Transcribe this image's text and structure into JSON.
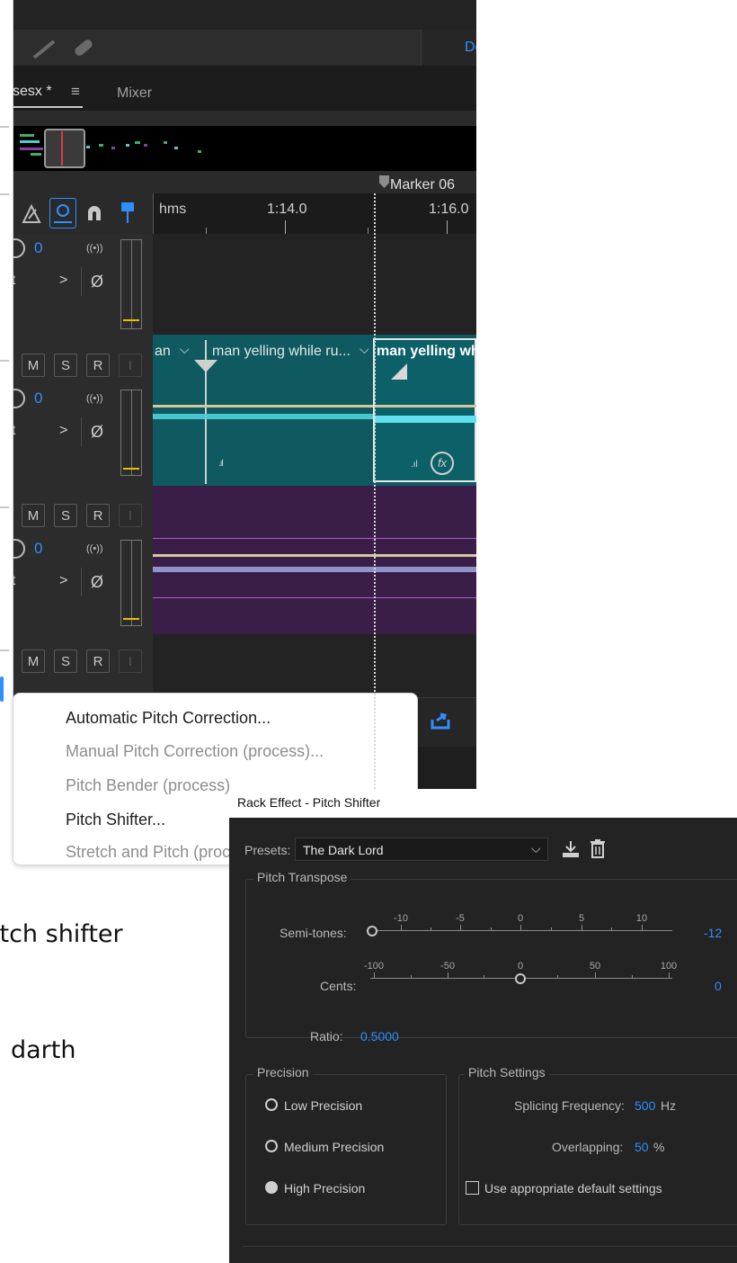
{
  "toolbar": {
    "workspace_label": "Def"
  },
  "tabs": {
    "session_tab": "sesx *",
    "menu_glyph": "≡",
    "mixer_tab": "Mixer"
  },
  "timeline": {
    "marker_label": "Marker 06",
    "ruler_unit": "hms",
    "time_1": "1:14.0",
    "time_2": "1:16.0"
  },
  "tracks": [
    {
      "volume": "0",
      "output": "ut",
      "arrow": ">",
      "phase": "Ø",
      "stereo": "((•))"
    },
    {
      "m": "M",
      "s": "S",
      "r": "R",
      "i": "I",
      "volume": "0",
      "output": "ut",
      "arrow": ">",
      "phase": "Ø",
      "stereo": "((•))"
    },
    {
      "m": "M",
      "s": "S",
      "r": "R",
      "i": "I",
      "volume": "0",
      "output": "ut",
      "arrow": ">",
      "phase": "Ø",
      "stereo": "((•))"
    },
    {
      "m": "M",
      "s": "S",
      "r": "R",
      "i": "I"
    }
  ],
  "clips": {
    "clip_a_title": "an",
    "clip_b_title": "man yelling while ru...",
    "clip_c_title": "man yelling whil",
    "fx_label": "fx"
  },
  "menu": {
    "items": [
      {
        "label": "Automatic Pitch Correction...",
        "enabled": true
      },
      {
        "label": "Manual Pitch Correction (process)...",
        "enabled": false
      },
      {
        "label": "Pitch Bender (process)",
        "enabled": false
      },
      {
        "label": "Pitch Shifter...",
        "enabled": true
      },
      {
        "label": "Stretch and Pitch (process)...",
        "enabled": false
      }
    ]
  },
  "slide": {
    "line_1": "itch shifter",
    "line_2": "darth"
  },
  "dialog": {
    "title": "Rack Effect - Pitch Shifter",
    "presets_label": "Presets:",
    "preset_value": "The Dark Lord",
    "pitch_transpose_title": "Pitch Transpose",
    "semitones_label": "Semi-tones:",
    "semitones_value": "-12",
    "semitones_ticks": [
      "-10",
      "-5",
      "0",
      "5",
      "10"
    ],
    "cents_label": "Cents:",
    "cents_value": "0",
    "cents_ticks": [
      "-100",
      "-50",
      "0",
      "50",
      "100"
    ],
    "ratio_label": "Ratio:",
    "ratio_value": "0.5000",
    "precision_title": "Precision",
    "precision_options": [
      "Low Precision",
      "Medium Precision",
      "High Precision"
    ],
    "precision_selected": "High Precision",
    "pitch_settings_title": "Pitch Settings",
    "splicing_label": "Splicing Frequency:",
    "splicing_value": "500",
    "splicing_unit": "Hz",
    "overlapping_label": "Overlapping:",
    "overlapping_value": "50",
    "overlapping_unit": "%",
    "default_settings_label": "Use appropriate default settings"
  },
  "colors": {
    "accent_blue": "#2e8fff",
    "clip_teal": "#0f5a60",
    "clip_purple": "#3b1e48",
    "meter_yellow": "#e3c300"
  }
}
